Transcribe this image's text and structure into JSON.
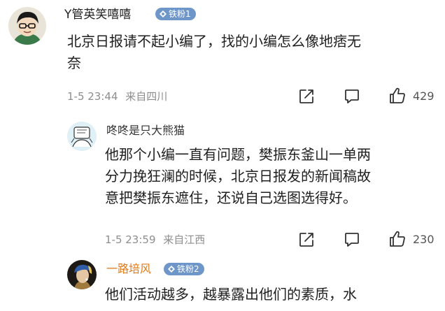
{
  "comments": [
    {
      "username": "Y管英笑嘻嘻",
      "badge": "铁粉1",
      "content_lines": [
        "北京日报请不起小编了，找的小编怎么像地痞无",
        "奈"
      ],
      "time": "1-5 23:44",
      "location": "来自四川",
      "likes": "429",
      "avatar_icon": "cartoon-boy-avatar-icon"
    },
    {
      "username": "咚咚是只大熊猫",
      "badge": "",
      "content_lines": [
        "他那个小编一直有问题，樊振东釜山一单两",
        "分力挽狂澜的时候，北京日报发的新闻稿故",
        "意把樊振东遮住，还说自己选图选得好。"
      ],
      "time": "1-5 23:59",
      "location": "来自江西",
      "likes": "230",
      "avatar_icon": "sketch-avatar-icon"
    },
    {
      "username": "一路培风",
      "badge": "铁粉2",
      "content_lines": [
        "他们活动越多，越暴露出他们的素质，水"
      ],
      "avatar_icon": "pearl-earring-avatar-icon"
    }
  ],
  "colors": {
    "badge_bg": "#6f96c9",
    "meta_text": "#8e8e8e",
    "username_reply": "#333333"
  }
}
